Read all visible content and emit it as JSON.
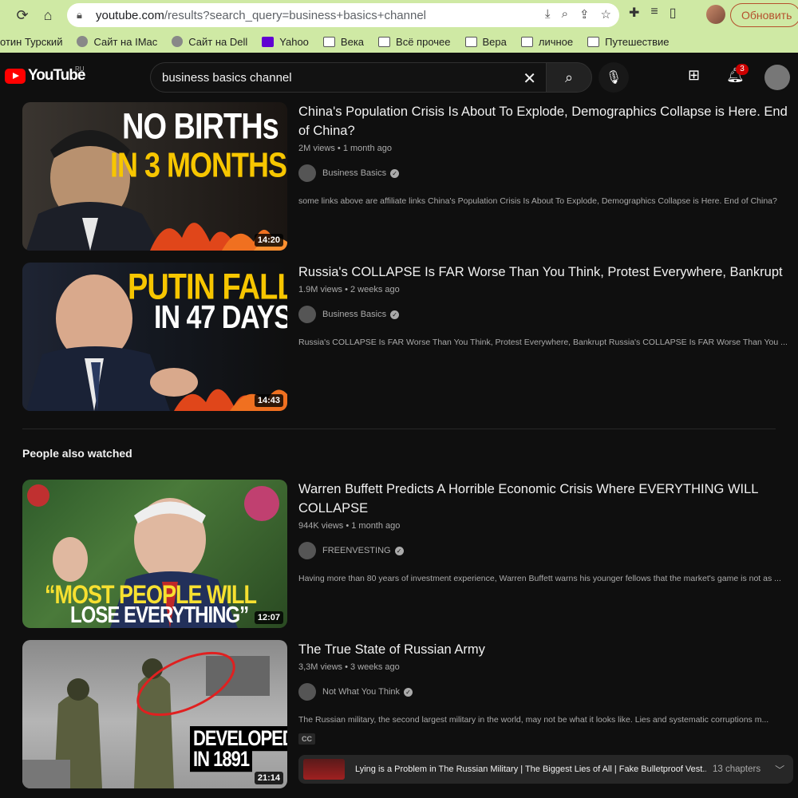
{
  "browser": {
    "url_host": "youtube.com",
    "url_path": "/results?search_query=business+basics+channel",
    "update_label": "Обновить",
    "bookmarks": [
      {
        "label": "отин Турский",
        "icon": "none"
      },
      {
        "label": "Сайт на IMac",
        "icon": "globe-icon"
      },
      {
        "label": "Сайт на Dell",
        "icon": "globe-icon"
      },
      {
        "label": "Yahoo",
        "icon": "yahoo-icon"
      },
      {
        "label": "Века",
        "icon": "folder-icon"
      },
      {
        "label": "Всё прочее",
        "icon": "folder-icon"
      },
      {
        "label": "Вера",
        "icon": "folder-icon"
      },
      {
        "label": "личное",
        "icon": "folder-icon"
      },
      {
        "label": "Путешествие",
        "icon": "folder-icon"
      }
    ]
  },
  "youtube": {
    "logo_text": "YouTube",
    "country": "RU",
    "search_query": "business basics channel",
    "notification_count": "3"
  },
  "results": [
    {
      "title": "China's Population Crisis Is About To Explode, Demographics Collapse is Here. End of China?",
      "views": "2M views",
      "age": "1 month ago",
      "channel": "Business Basics",
      "description": "some links above are affiliate links China's Population Crisis Is About To Explode, Demographics Collapse is Here. End of China?",
      "duration": "14:20",
      "thumb_line1": "NO BIRTHs",
      "thumb_line2": "IN 3 MONTHS"
    },
    {
      "title": "Russia's COLLAPSE Is FAR Worse Than You Think, Protest Everywhere, Bankrupt",
      "views": "1.9M views",
      "age": "2 weeks ago",
      "channel": "Business Basics",
      "description": "Russia's COLLAPSE Is FAR Worse Than You Think, Protest Everywhere, Bankrupt Russia's COLLAPSE Is FAR Worse Than You ...",
      "duration": "14:43",
      "thumb_line1": "PUTIN FALL",
      "thumb_line2": "IN 47 DAYS"
    }
  ],
  "section_title": "People also watched",
  "also_watched": [
    {
      "title": "Warren Buffett Predicts A Horrible Economic Crisis Where EVERYTHING WILL COLLAPSE",
      "views": "944K views",
      "age": "1 month ago",
      "channel": "FREENVESTING",
      "description": "Having more than 80 years of investment experience, Warren Buffett warns his younger fellows that the market's game is not as ...",
      "duration": "12:07",
      "thumb_line1": "“MOST PEOPLE WILL",
      "thumb_line2": "LOSE EVERYTHING”"
    },
    {
      "title": "The True State of Russian Army",
      "views": "3,3M views",
      "age": "3 weeks ago",
      "channel": "Not What You Think",
      "description": "The Russian military, the second largest military in the world, may not be what it looks like. Lies and systematic corruptions m...",
      "duration": "21:14",
      "thumb_line1": "DEVELOPED",
      "thumb_line2": "IN 1891",
      "cc": "CC",
      "chapter_text": "Lying is a Problem in The Russian Military | The Biggest Lies of All | Fake Bulletproof Vest...",
      "chapter_count": "13 chapters"
    }
  ]
}
